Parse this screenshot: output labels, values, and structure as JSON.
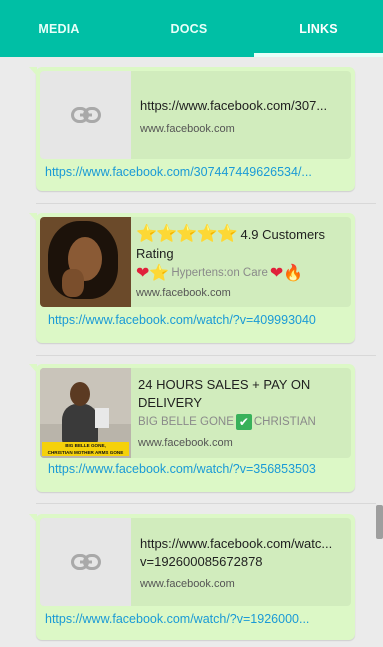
{
  "tabs": [
    {
      "label": "MEDIA"
    },
    {
      "label": "DOCS"
    },
    {
      "label": "LINKS"
    }
  ],
  "active_tab": "LINKS",
  "links": [
    {
      "preview_title": "https://www.facebook.com/307...",
      "domain": "www.facebook.com",
      "url": "https://www.facebook.com/307447449626534/..."
    },
    {
      "rating_prefix": "⭐⭐⭐⭐⭐",
      "rating_text": "4.9 Customers",
      "rating_line2": "Rating",
      "desc_prefix": "❤⭐",
      "desc_text": "Hypertens:on Care",
      "desc_suffix": "❤🔥",
      "domain": "www.facebook.com",
      "url": "https://www.facebook.com/watch/?v=409993040"
    },
    {
      "preview_title_line1": "24 HOURS SALES + PAY ON",
      "preview_title_line2": "DELIVERY",
      "desc_name1": "BIG BELLE GONE",
      "desc_name2": "CHRISTIAN",
      "thumb_caption_line1": "BIG BELLE GONE,",
      "thumb_caption_line2": "CHRISTIAN MOTHER ARMS GONE",
      "domain": "www.facebook.com",
      "url": "https://www.facebook.com/watch/?v=356853503"
    },
    {
      "preview_title_line1": "https://www.facebook.com/watc...",
      "preview_title_line2": "v=192600085672878",
      "domain": "www.facebook.com",
      "url": "https://www.facebook.com/watch/?v=1926000..."
    }
  ],
  "colors": {
    "header": "#00bfa5",
    "bubble": "#dcf8c6",
    "link": "#1a9ad6"
  },
  "icons": {
    "link_placeholder": "link-icon"
  }
}
